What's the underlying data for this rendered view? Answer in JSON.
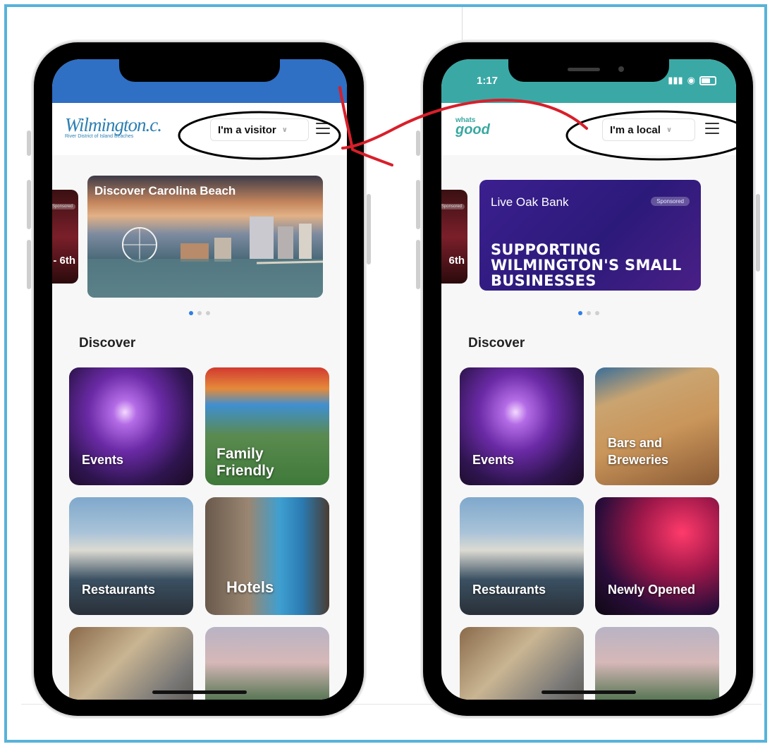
{
  "left_phone": {
    "brand_main": "Wilmington.c.",
    "brand_sub": "River District of Island Beaches",
    "mode_select": "I'm a visitor",
    "carousel_side_chip": "Sponsored",
    "carousel_side_text": "- 6th",
    "banner_title": "Discover Carolina Beach",
    "section_title": "Discover",
    "tiles": [
      "Events",
      "Family Friendly",
      "Restaurants",
      "Hotels"
    ],
    "header_color": "#2f6fc4"
  },
  "right_phone": {
    "status_time": "1:17",
    "brand_small": "whats",
    "brand_big": "good",
    "mode_select": "I'm a local",
    "carousel_side_chip": "Sponsored",
    "carousel_side_text": "6th",
    "banner_name": "Live Oak Bank",
    "banner_chip": "Sponsored",
    "banner_tagline": "SUPPORTING WILMINGTON'S SMALL BUSINESSES",
    "section_title": "Discover",
    "tiles": [
      "Events",
      "Bars and Breweries",
      "Restaurants",
      "Newly Opened"
    ],
    "header_color": "#3aa9a6"
  },
  "colors": {
    "frame_border": "#58b3d9",
    "annotation_red": "#d81f2a",
    "dot_active": "#2f7ee6"
  }
}
